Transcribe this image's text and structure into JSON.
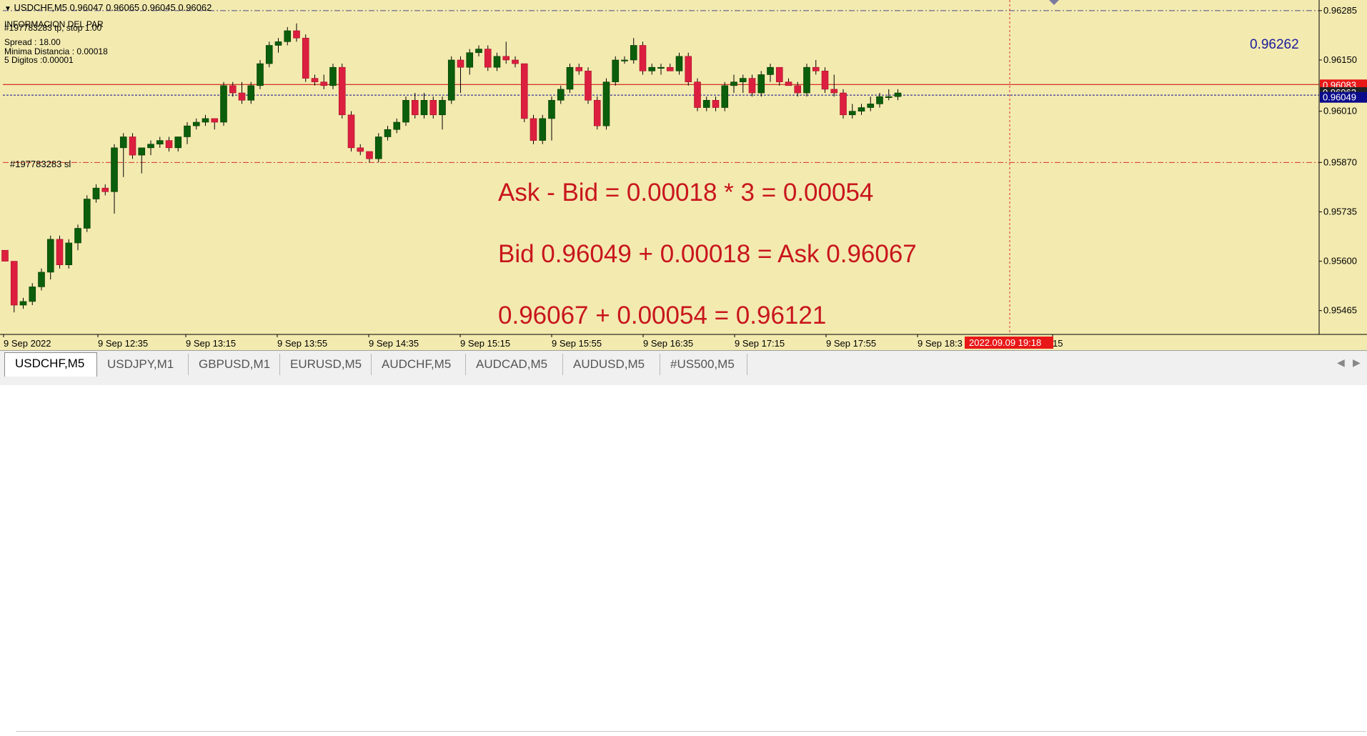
{
  "header": {
    "symbol_line": "USDCHF,M5  0.96047 0.96065 0.96045 0.96062",
    "info_title": "INFORMACION DEL PAR",
    "order_tp": "#197783283 tp, stop 1.00",
    "spread": "Spread  : 18.00",
    "min_distance": "Minima Distancia : 0.00018",
    "digits": "5  Digitos :0.00001",
    "sl_label": "#197783283 sl"
  },
  "annotations": {
    "line1": "Ask - Bid = 0.00018 * 3 = 0.00054",
    "line2": "Bid 0.96049 + 0.00018 =  Ask 0.96067",
    "line3": "0.96067 + 0.00054 = 0.96121"
  },
  "level_label": "0.96262",
  "crosshair_time": "2022.09.09 19:18",
  "colors": {
    "background": "#f3eab0",
    "bull": "#0b5e0b",
    "bear": "#dc1f3f",
    "annotation": "#c8161d",
    "ask_line": "#cc0000",
    "bid_line": "#0b0b8c"
  },
  "chart_data": {
    "type": "candlestick",
    "symbol": "USDCHF",
    "timeframe": "M5",
    "ylim": [
      0.9538,
      0.9633
    ],
    "y_ticks": [
      "0.96285",
      "0.96150",
      "0.96010",
      "0.95870",
      "0.95735",
      "0.95600",
      "0.95465"
    ],
    "x_ticks": [
      "9 Sep 2022",
      "9 Sep 12:35",
      "9 Sep 13:15",
      "9 Sep 13:55",
      "9 Sep 14:35",
      "9 Sep 15:15",
      "9 Sep 15:55",
      "9 Sep 16:35",
      "9 Sep 17:15",
      "9 Sep 17:55",
      "9 Sep 18:3",
      "15"
    ],
    "price_tags": [
      {
        "label": "0.96083",
        "value": 0.96083,
        "color": "#e81818"
      },
      {
        "label": "0.96062",
        "value": 0.96062,
        "color": "#222222"
      },
      {
        "label": "0.96049",
        "value": 0.96049,
        "color": "#0b0b8c"
      }
    ],
    "levels": [
      {
        "name": "tp",
        "value": 0.96285,
        "style": "dashdot",
        "color": "#4a4a88"
      },
      {
        "name": "ask",
        "value": 0.96083,
        "style": "solid",
        "color": "#cc0000"
      },
      {
        "name": "bid",
        "value": 0.96054,
        "style": "dashed",
        "color": "#0b0b8c"
      },
      {
        "name": "sl",
        "value": 0.9587,
        "style": "dashdot",
        "color": "#d43030"
      }
    ],
    "candles": [
      [
        0.9563,
        0.9563,
        0.956,
        0.956
      ],
      [
        0.956,
        0.956,
        0.9546,
        0.9548
      ],
      [
        0.9548,
        0.955,
        0.9547,
        0.9549
      ],
      [
        0.9549,
        0.9554,
        0.9548,
        0.9553
      ],
      [
        0.9553,
        0.9558,
        0.9552,
        0.9557
      ],
      [
        0.9557,
        0.9567,
        0.9555,
        0.9566
      ],
      [
        0.9566,
        0.9567,
        0.9558,
        0.9559
      ],
      [
        0.9559,
        0.9566,
        0.9558,
        0.9565
      ],
      [
        0.9565,
        0.957,
        0.9563,
        0.9569
      ],
      [
        0.9569,
        0.9578,
        0.9568,
        0.9577
      ],
      [
        0.9577,
        0.9581,
        0.9576,
        0.958
      ],
      [
        0.958,
        0.9581,
        0.9578,
        0.9579
      ],
      [
        0.9579,
        0.9592,
        0.9573,
        0.9591
      ],
      [
        0.9591,
        0.9595,
        0.9583,
        0.9594
      ],
      [
        0.9594,
        0.9595,
        0.9588,
        0.9589
      ],
      [
        0.9589,
        0.959,
        0.9584,
        0.9591
      ],
      [
        0.9591,
        0.9593,
        0.9589,
        0.9592
      ],
      [
        0.9592,
        0.9594,
        0.9591,
        0.9593
      ],
      [
        0.9593,
        0.9594,
        0.959,
        0.9591
      ],
      [
        0.9591,
        0.9594,
        0.959,
        0.9594
      ],
      [
        0.9594,
        0.9598,
        0.9592,
        0.9597
      ],
      [
        0.9597,
        0.9599,
        0.9596,
        0.9598
      ],
      [
        0.9598,
        0.96,
        0.9597,
        0.9599
      ],
      [
        0.9599,
        0.9599,
        0.9596,
        0.9598
      ],
      [
        0.9598,
        0.9609,
        0.9597,
        0.9608
      ],
      [
        0.9608,
        0.9609,
        0.9605,
        0.9606
      ],
      [
        0.9606,
        0.9609,
        0.9603,
        0.9604
      ],
      [
        0.9604,
        0.9609,
        0.9603,
        0.9608
      ],
      [
        0.9608,
        0.9615,
        0.9607,
        0.9614
      ],
      [
        0.9614,
        0.962,
        0.9613,
        0.9619
      ],
      [
        0.9619,
        0.9621,
        0.9617,
        0.962
      ],
      [
        0.962,
        0.9624,
        0.9619,
        0.9623
      ],
      [
        0.9623,
        0.9625,
        0.962,
        0.9621
      ],
      [
        0.9621,
        0.9622,
        0.9609,
        0.961
      ],
      [
        0.961,
        0.9611,
        0.9608,
        0.9609
      ],
      [
        0.9609,
        0.9611,
        0.9607,
        0.9608
      ],
      [
        0.9608,
        0.9614,
        0.9607,
        0.9613
      ],
      [
        0.9613,
        0.9614,
        0.9599,
        0.96
      ],
      [
        0.96,
        0.9601,
        0.959,
        0.9591
      ],
      [
        0.9591,
        0.9592,
        0.9589,
        0.959
      ],
      [
        0.959,
        0.959,
        0.9587,
        0.9588
      ],
      [
        0.9588,
        0.9595,
        0.9587,
        0.9594
      ],
      [
        0.9594,
        0.9597,
        0.9593,
        0.9596
      ],
      [
        0.9596,
        0.9599,
        0.9595,
        0.9598
      ],
      [
        0.9598,
        0.9605,
        0.9597,
        0.9604
      ],
      [
        0.9604,
        0.9606,
        0.9599,
        0.96
      ],
      [
        0.96,
        0.9606,
        0.9599,
        0.9604
      ],
      [
        0.9604,
        0.9605,
        0.9599,
        0.96
      ],
      [
        0.96,
        0.9605,
        0.9596,
        0.9604
      ],
      [
        0.9604,
        0.9616,
        0.9603,
        0.9615
      ],
      [
        0.9615,
        0.9616,
        0.9606,
        0.9613
      ],
      [
        0.9613,
        0.9618,
        0.9611,
        0.9617
      ],
      [
        0.9617,
        0.9619,
        0.9616,
        0.9618
      ],
      [
        0.9618,
        0.9619,
        0.9612,
        0.9613
      ],
      [
        0.9613,
        0.9617,
        0.9612,
        0.9616
      ],
      [
        0.9616,
        0.962,
        0.9614,
        0.9615
      ],
      [
        0.9615,
        0.9616,
        0.9613,
        0.9614
      ],
      [
        0.9614,
        0.9614,
        0.9598,
        0.9599
      ],
      [
        0.9599,
        0.96,
        0.9592,
        0.9593
      ],
      [
        0.9593,
        0.96,
        0.9592,
        0.9599
      ],
      [
        0.9599,
        0.9605,
        0.9593,
        0.9604
      ],
      [
        0.9604,
        0.9608,
        0.9603,
        0.9607
      ],
      [
        0.9607,
        0.9614,
        0.9606,
        0.9613
      ],
      [
        0.9613,
        0.9614,
        0.9611,
        0.9612
      ],
      [
        0.9612,
        0.9613,
        0.9603,
        0.9604
      ],
      [
        0.9604,
        0.9605,
        0.9596,
        0.9597
      ],
      [
        0.9597,
        0.961,
        0.9596,
        0.9609
      ],
      [
        0.9609,
        0.9616,
        0.9608,
        0.9615
      ],
      [
        0.9615,
        0.9616,
        0.9614,
        0.9615
      ],
      [
        0.9615,
        0.9621,
        0.9614,
        0.9619
      ],
      [
        0.9619,
        0.962,
        0.9611,
        0.9612
      ],
      [
        0.9612,
        0.9614,
        0.9611,
        0.9613
      ],
      [
        0.9613,
        0.9614,
        0.9611,
        0.9613
      ],
      [
        0.9613,
        0.9614,
        0.9612,
        0.9612
      ],
      [
        0.9612,
        0.9617,
        0.9611,
        0.9616
      ],
      [
        0.9616,
        0.9617,
        0.9608,
        0.9609
      ],
      [
        0.9609,
        0.961,
        0.9601,
        0.9602
      ],
      [
        0.9602,
        0.9605,
        0.9601,
        0.9604
      ],
      [
        0.9604,
        0.9605,
        0.9601,
        0.9602
      ],
      [
        0.9602,
        0.9609,
        0.9601,
        0.9608
      ],
      [
        0.9608,
        0.9611,
        0.9606,
        0.9609
      ],
      [
        0.9609,
        0.9611,
        0.9606,
        0.961
      ],
      [
        0.961,
        0.9611,
        0.9605,
        0.9606
      ],
      [
        0.9606,
        0.9612,
        0.9605,
        0.9611
      ],
      [
        0.9611,
        0.9614,
        0.9609,
        0.9613
      ],
      [
        0.9613,
        0.9613,
        0.9608,
        0.9609
      ],
      [
        0.9609,
        0.961,
        0.9608,
        0.9608
      ],
      [
        0.9608,
        0.9609,
        0.9605,
        0.9606
      ],
      [
        0.9606,
        0.9614,
        0.9605,
        0.9613
      ],
      [
        0.9613,
        0.9615,
        0.9611,
        0.9612
      ],
      [
        0.9612,
        0.9613,
        0.9606,
        0.9607
      ],
      [
        0.9607,
        0.9611,
        0.9605,
        0.9606
      ],
      [
        0.9606,
        0.9607,
        0.9599,
        0.96
      ],
      [
        0.96,
        0.9603,
        0.9599,
        0.9601
      ],
      [
        0.9601,
        0.9603,
        0.96,
        0.9602
      ],
      [
        0.9602,
        0.9605,
        0.9601,
        0.9603
      ],
      [
        0.9603,
        0.9606,
        0.9602,
        0.9605
      ],
      [
        0.9605,
        0.9607,
        0.9604,
        0.9605
      ],
      [
        0.9605,
        0.9607,
        0.9604,
        0.9606
      ]
    ]
  },
  "tabs": [
    "USDCHF,M5",
    "USDJPY,M1",
    "GBPUSD,M1",
    "EURUSD,M5",
    "AUDCHF,M5",
    "AUDCAD,M5",
    "AUDUSD,M5",
    "#US500,M5"
  ],
  "active_tab": 0
}
